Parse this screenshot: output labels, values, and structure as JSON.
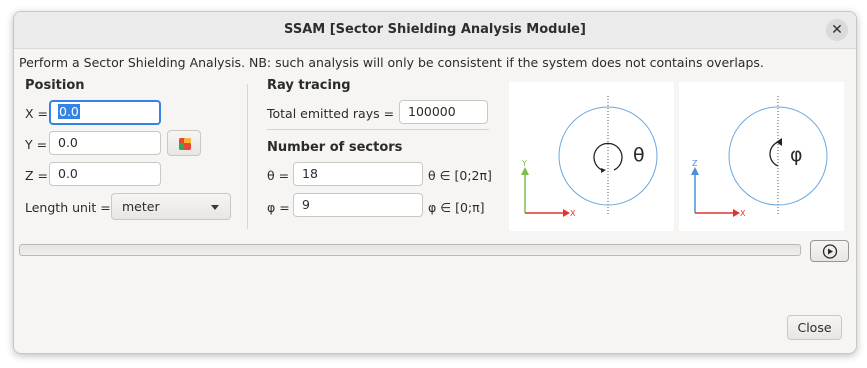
{
  "window": {
    "title": "SSAM [Sector Shielding Analysis Module]"
  },
  "description": "Perform a Sector Shielding Analysis. NB: such analysis will only be consistent if the system does not contains overlaps.",
  "position": {
    "header": "Position",
    "x_label": "X =",
    "x_value": "0.0",
    "y_label": "Y =",
    "y_value": "0.0",
    "z_label": "Z =",
    "z_value": "0.0",
    "unit_label": "Length unit =",
    "unit_value": "meter"
  },
  "ray_tracing": {
    "header": "Ray tracing",
    "rays_label": "Total emitted rays =",
    "rays_value": "100000"
  },
  "sectors": {
    "header": "Number of sectors",
    "theta_label": "θ =",
    "theta_value": "18",
    "theta_range": "θ ∈ [0;2π]",
    "phi_label": "φ =",
    "phi_value": "9",
    "phi_range": "φ ∈ [0;π]"
  },
  "diagrams": [
    {
      "symbol": "θ",
      "axis_vertical": "Y",
      "axis_horizontal": "X",
      "vertical_color": "#7cc04a",
      "horizontal_color": "#e0352b"
    },
    {
      "symbol": "φ",
      "axis_vertical": "Z",
      "axis_horizontal": "X",
      "vertical_color": "#4a90d9",
      "horizontal_color": "#e0352b"
    }
  ],
  "progress": {
    "value": 0
  },
  "buttons": {
    "close": "Close",
    "run_icon": "play-icon",
    "pick_icon": "color-picker-icon"
  }
}
